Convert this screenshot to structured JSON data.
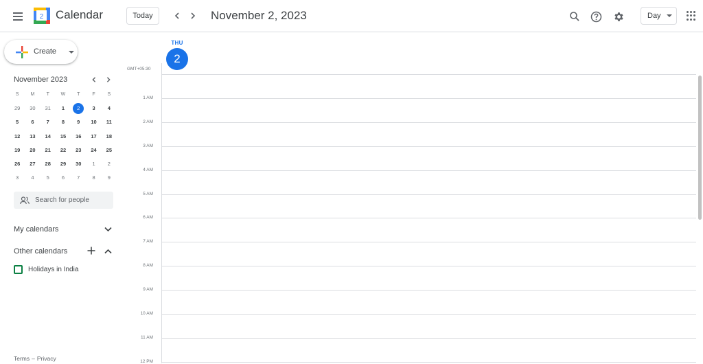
{
  "header": {
    "app_title": "Calendar",
    "logo_day": "2",
    "today_label": "Today",
    "date_title": "November 2, 2023",
    "view_label": "Day"
  },
  "create": {
    "label": "Create"
  },
  "mini_calendar": {
    "title": "November 2023",
    "weekdays": [
      "S",
      "M",
      "T",
      "W",
      "T",
      "F",
      "S"
    ],
    "weeks": [
      [
        {
          "d": "29",
          "t": "other"
        },
        {
          "d": "30",
          "t": "other"
        },
        {
          "d": "31",
          "t": "other"
        },
        {
          "d": "1",
          "t": "cur"
        },
        {
          "d": "2",
          "t": "sel"
        },
        {
          "d": "3",
          "t": "cur"
        },
        {
          "d": "4",
          "t": "cur"
        }
      ],
      [
        {
          "d": "5",
          "t": "cur"
        },
        {
          "d": "6",
          "t": "cur"
        },
        {
          "d": "7",
          "t": "cur"
        },
        {
          "d": "8",
          "t": "cur"
        },
        {
          "d": "9",
          "t": "cur"
        },
        {
          "d": "10",
          "t": "cur"
        },
        {
          "d": "11",
          "t": "cur"
        }
      ],
      [
        {
          "d": "12",
          "t": "cur"
        },
        {
          "d": "13",
          "t": "cur"
        },
        {
          "d": "14",
          "t": "cur"
        },
        {
          "d": "15",
          "t": "cur"
        },
        {
          "d": "16",
          "t": "cur"
        },
        {
          "d": "17",
          "t": "cur"
        },
        {
          "d": "18",
          "t": "cur"
        }
      ],
      [
        {
          "d": "19",
          "t": "cur"
        },
        {
          "d": "20",
          "t": "cur"
        },
        {
          "d": "21",
          "t": "cur"
        },
        {
          "d": "22",
          "t": "cur"
        },
        {
          "d": "23",
          "t": "cur"
        },
        {
          "d": "24",
          "t": "cur"
        },
        {
          "d": "25",
          "t": "cur"
        }
      ],
      [
        {
          "d": "26",
          "t": "cur"
        },
        {
          "d": "27",
          "t": "cur"
        },
        {
          "d": "28",
          "t": "cur"
        },
        {
          "d": "29",
          "t": "cur"
        },
        {
          "d": "30",
          "t": "cur"
        },
        {
          "d": "1",
          "t": "other"
        },
        {
          "d": "2",
          "t": "other"
        }
      ],
      [
        {
          "d": "3",
          "t": "other"
        },
        {
          "d": "4",
          "t": "other"
        },
        {
          "d": "5",
          "t": "other"
        },
        {
          "d": "6",
          "t": "other"
        },
        {
          "d": "7",
          "t": "other"
        },
        {
          "d": "8",
          "t": "other"
        },
        {
          "d": "9",
          "t": "other"
        }
      ]
    ]
  },
  "search_people": {
    "placeholder": "Search for people"
  },
  "my_calendars": {
    "title": "My calendars"
  },
  "other_calendars": {
    "title": "Other calendars",
    "items": [
      {
        "label": "Holidays in India",
        "color": "#0b8043"
      }
    ]
  },
  "footer": {
    "terms": "Terms",
    "separator": "–",
    "privacy": "Privacy"
  },
  "day_view": {
    "dow": "THU",
    "day_number": "2",
    "timezone": "GMT+05:30",
    "hours": [
      "1 AM",
      "2 AM",
      "3 AM",
      "4 AM",
      "5 AM",
      "6 AM",
      "7 AM",
      "8 AM",
      "9 AM",
      "10 AM",
      "11 AM",
      "12 PM"
    ]
  },
  "colors": {
    "accent": "#1a73e8",
    "divider": "#dadce0"
  },
  "icons": {
    "menu": "hamburger-menu-icon",
    "prev": "chevron-left-icon",
    "next": "chevron-right-icon",
    "search": "search-icon",
    "help": "help-icon",
    "settings": "gear-icon",
    "apps": "apps-grid-icon"
  }
}
